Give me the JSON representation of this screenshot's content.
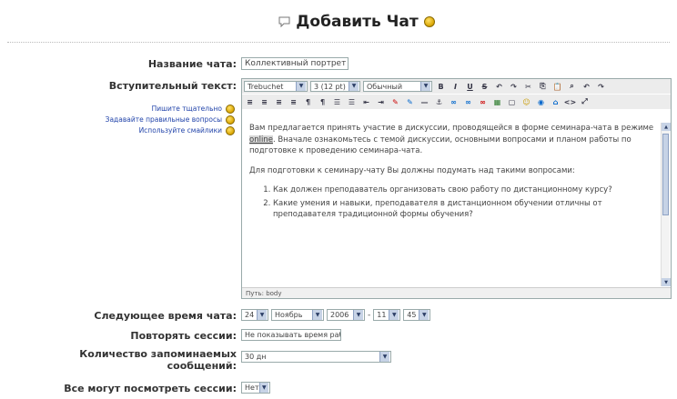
{
  "header": {
    "title": "Добавить Чат"
  },
  "form": {
    "name_label": "Название чата:",
    "name_value": "Коллективный портрет образ",
    "intro_label": "Вступительный текст:",
    "help_links": [
      "Пишите тщательно",
      "Задавайте правильные вопросы",
      "Используйте смайлики"
    ],
    "toolbar": {
      "font": "Trebuchet",
      "size": "3 (12 pt)",
      "style": "Обычный",
      "row1_buttons": [
        "B",
        "I",
        "U",
        "S",
        "↶",
        "↷",
        "✂",
        "⎘",
        "📋",
        "⌕",
        "↶",
        "↷"
      ],
      "row2_buttons": [
        "≡",
        "≡",
        "≡",
        "≡",
        "¶",
        "¶",
        "☰",
        "☰",
        "⇤",
        "⇥",
        "✎",
        "✎",
        "—",
        "⚓",
        "∞",
        "∞",
        "∞",
        "▦",
        "▢",
        "☺",
        "◉",
        "⌂",
        "<>",
        "⤢"
      ]
    },
    "editor_text": {
      "p1_before": "Вам предлагается принять участие в дискуссии, проводящейся в форме семинара-чата в режиме ",
      "p1_highlight": "online",
      "p1_after": ". Вначале ознакомьтесь с темой дискуссии, основными вопросами и планом работы по подготовке к проведению семинара-чата.",
      "p2": "Для подготовки к семинару-чату Вы должны подумать над такими вопросами:",
      "items": [
        "Как должен преподаватель организовать свою работу по дистанционному курсу?",
        "Какие умения и навыки, преподавателя в дистанционном обучении отличны от преподавателя традиционной формы обучения?"
      ],
      "path": "Путь: body"
    },
    "time_label": "Следующее время чата:",
    "time": {
      "day": "24",
      "month": "Ноябрь",
      "year": "2006",
      "dash": "-",
      "hour": "11",
      "minute": "45"
    },
    "repeat_label": "Повторять сессии:",
    "repeat_value": "Не показывать время работы чата",
    "keep_label_line1": "Количество запоминаемых",
    "keep_label_line2": "сообщений:",
    "keep_value": "30 дн",
    "view_label": "Все могут посмотреть сессии:",
    "view_value": "Нет"
  }
}
